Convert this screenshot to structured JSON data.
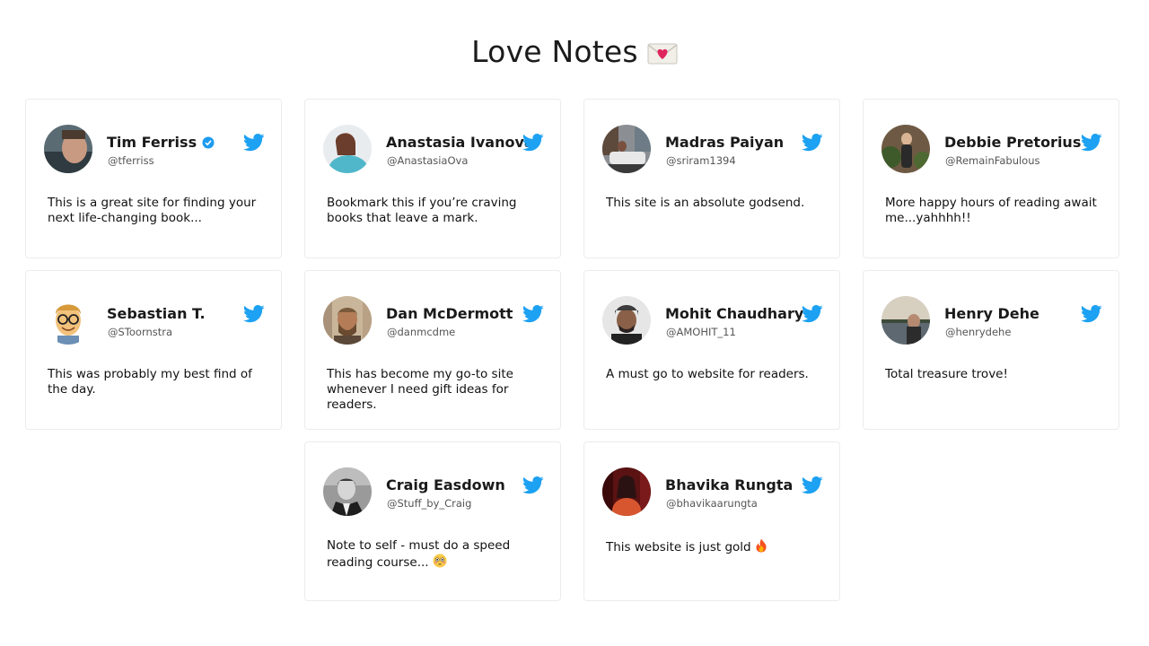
{
  "page": {
    "title": "Love Notes",
    "title_icon": "love-letter-icon"
  },
  "colors": {
    "twitter": "#1da1f2",
    "verified": "#1d9bf0",
    "border": "#ececec"
  },
  "tweets": [
    {
      "name": "Tim Ferriss",
      "handle": "@tferriss",
      "verified": true,
      "text": "This is a great site for finding your next life-changing book..."
    },
    {
      "name": "Anastasia Ivanova",
      "handle": "@AnastasiaOva",
      "text": "Bookmark this if you’re craving books that leave a mark."
    },
    {
      "name": "Madras Paiyan",
      "handle": "@sriram1394",
      "text": "This site is an absolute godsend."
    },
    {
      "name": "Debbie Pretorius",
      "handle": "@RemainFabulous",
      "text": "More happy hours of reading await me...yahhhh!!"
    },
    {
      "name": "Sebastian T.",
      "handle": "@SToornstra",
      "text": "This was probably my best find of the day."
    },
    {
      "name": "Dan McDermott",
      "handle": "@danmcdme",
      "text": "This has become my go-to site whenever I need gift ideas for readers."
    },
    {
      "name": "Mohit Chaudhary",
      "handle": "@AMOHIT_11",
      "text": "A must go to website for readers."
    },
    {
      "name": "Henry Dehe",
      "handle": "@henrydehe",
      "text": "Total treasure trove!"
    },
    {
      "name": "Craig Easdown",
      "handle": "@Stuff_by_Craig",
      "text": "Note to self - must do a speed reading course...",
      "emoji": "flushed-face-icon"
    },
    {
      "name": "Bhavika Rungta",
      "handle": "@bhavikaarungta",
      "text": "This website is just gold",
      "emoji": "fire-icon"
    }
  ]
}
